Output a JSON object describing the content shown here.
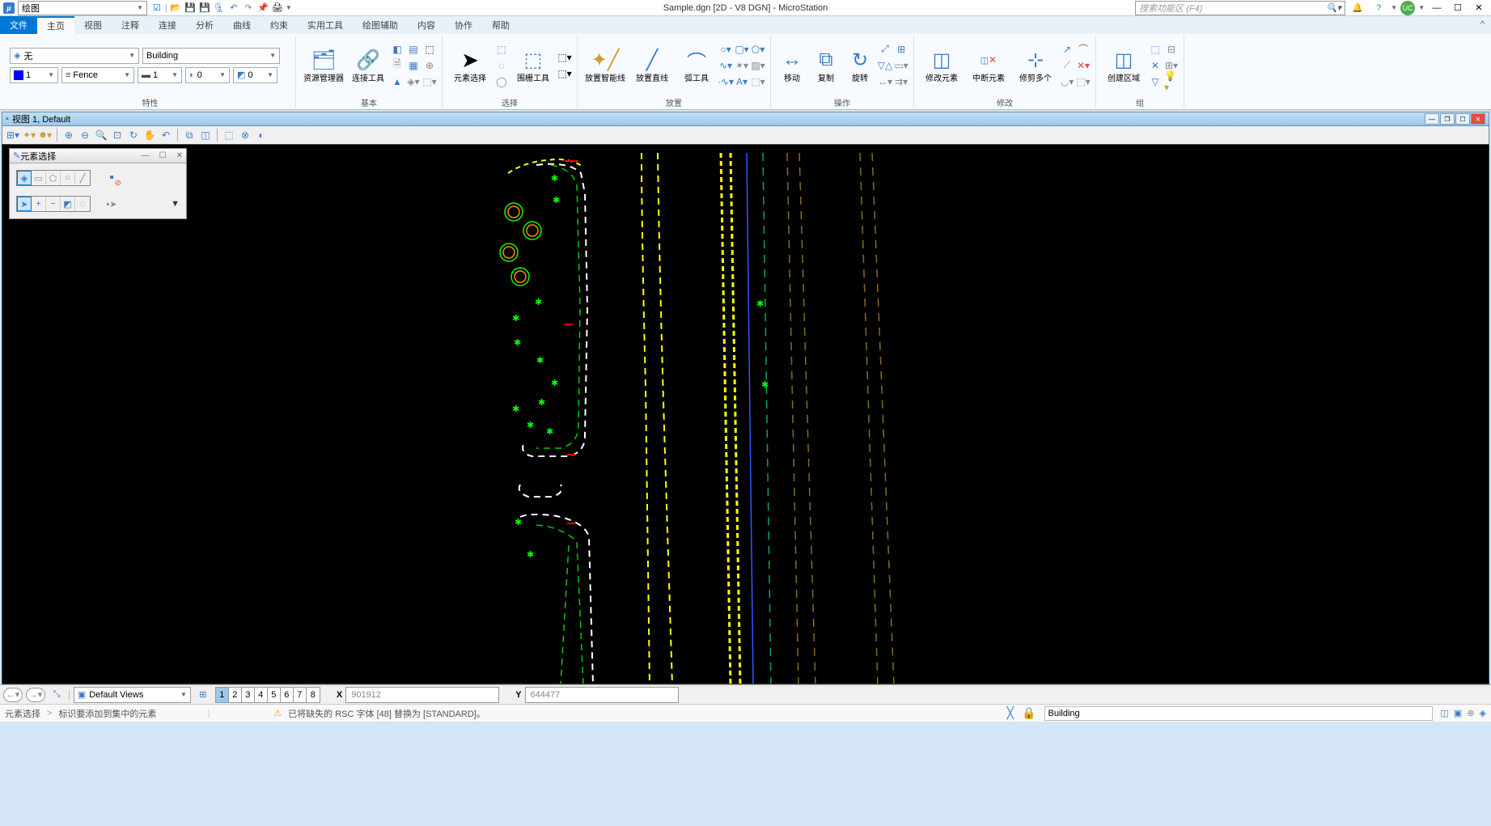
{
  "titlebar": {
    "qat_label": "绘图",
    "title": "Sample.dgn [2D - V8 DGN] - MicroStation",
    "search_placeholder": "搜索功能区 (F4)",
    "user_badge": "UC"
  },
  "tabs": {
    "file": "文件",
    "items": [
      "主页",
      "视图",
      "注释",
      "连接",
      "分析",
      "曲线",
      "约束",
      "实用工具",
      "绘图辅助",
      "内容",
      "协作",
      "帮助"
    ],
    "active": "主页"
  },
  "ribbon": {
    "groups": {
      "attr": "特性",
      "basic": "基本",
      "select": "选择",
      "place": "放置",
      "manip": "操作",
      "modify": "修改",
      "group": "组"
    },
    "attr_top_left": "无",
    "attr_top_right": "Building",
    "attr_color": "1",
    "attr_fence": "Fence",
    "attr_weight": "1",
    "attr_style": "0",
    "attr_priority": "0",
    "basic_explorer": "资源管理器",
    "basic_attach": "连接工具",
    "select_elem": "元素选择",
    "select_fence": "围栅工具",
    "place_smart": "放置智能线",
    "place_line": "放置直线",
    "place_arc": "弧工具",
    "manip_move": "移动",
    "manip_copy": "复制",
    "manip_rotate": "旋转",
    "modify_elem": "修改元素",
    "modify_break": "中断元素",
    "modify_trim": "修剪多个",
    "group_region": "创建区域"
  },
  "view": {
    "header": "视图 1, Default"
  },
  "palette": {
    "title": "元素选择"
  },
  "bottom": {
    "views_label": "Default Views",
    "view_numbers": [
      "1",
      "2",
      "3",
      "4",
      "5",
      "6",
      "7",
      "8"
    ],
    "x_label": "X",
    "x_value": "901912",
    "y_label": "Y",
    "y_value": "644477",
    "status_left": "元素选择",
    "status_right": "标识要添加到集中的元素",
    "warning": "已将缺失的 RSC 字体 [48] 替换为 [STANDARD]。",
    "snap_model": "Building"
  }
}
